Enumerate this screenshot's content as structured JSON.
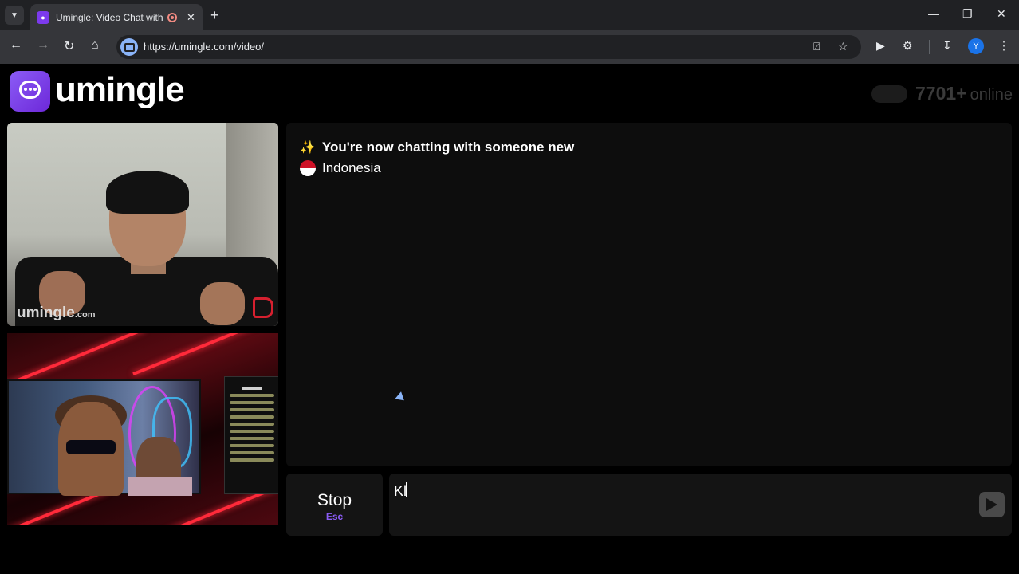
{
  "browser": {
    "tab_title": "Umingle: Video Chat with St",
    "url": "https://umingle.com/video/",
    "profile_initial": "Y"
  },
  "site": {
    "brand": "umingle",
    "online_count": "7701+",
    "online_label": "online"
  },
  "video": {
    "watermark": "umingle",
    "watermark_suffix": ".com"
  },
  "chat": {
    "system_message": "You're now chatting with someone new",
    "country": "Indonesia",
    "stop_label": "Stop",
    "stop_shortcut": "Esc",
    "input_value": "Kl"
  },
  "colors": {
    "accent": "#8b5cf6",
    "background": "#000000",
    "panel": "#0d0d0d"
  }
}
